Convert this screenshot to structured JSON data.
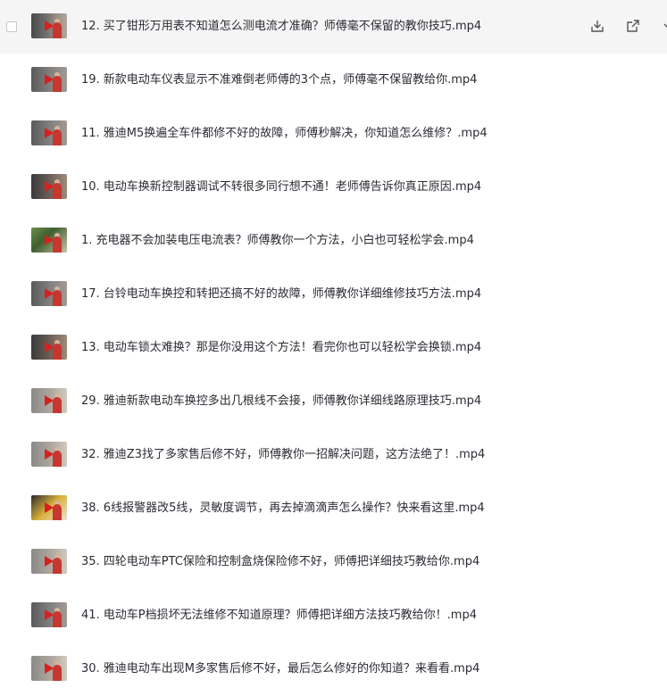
{
  "files": [
    {
      "title": "12. 买了钳形万用表不知道怎么测电流才准确？师傅毫不保留的教你技巧.mp4",
      "thumb": "v1"
    },
    {
      "title": "19. 新款电动车仪表显示不准难倒老师傅的3个点，师傅毫不保留教给你.mp4",
      "thumb": "v2"
    },
    {
      "title": "11. 雅迪M5换遍全车件都修不好的故障，师傅秒解决，你知道怎么维修？.mp4",
      "thumb": "v2"
    },
    {
      "title": "10. 电动车换新控制器调试不转很多同行想不通！老师傅告诉你真正原因.mp4",
      "thumb": "v3"
    },
    {
      "title": "1. 充电器不会加装电压电流表？师傅教你一个方法，小白也可轻松学会.mp4",
      "thumb": "v4"
    },
    {
      "title": "17. 台铃电动车换控和转把还搞不好的故障，师傅教你详细维修技巧方法.mp4",
      "thumb": "v2"
    },
    {
      "title": "13. 电动车锁太难换？那是你没用这个方法！看完你也可以轻松学会换锁.mp4",
      "thumb": "v3"
    },
    {
      "title": "29. 雅迪新款电动车换控多出几根线不会接，师傅教你详细线路原理技巧.mp4",
      "thumb": "v5"
    },
    {
      "title": "32. 雅迪Z3找了多家售后修不好，师傅教你一招解决问题，这方法绝了！.mp4",
      "thumb": "v5"
    },
    {
      "title": "38. 6线报警器改5线，灵敏度调节，再去掉滴滴声怎么操作？快来看这里.mp4",
      "thumb": "v6"
    },
    {
      "title": "35. 四轮电动车PTC保险和控制盒烧保险修不好，师傅把详细技巧教给你.mp4",
      "thumb": "v5"
    },
    {
      "title": "41. 电动车P档损坏无法维修不知道原理？师傅把详细方法技巧教给你！.mp4",
      "thumb": "v2"
    },
    {
      "title": "30. 雅迪电动车出现M多家售后修不好，最后怎么修好的你知道？来看看.mp4",
      "thumb": "v5"
    }
  ],
  "row_actions": {
    "download_icon": "download-icon",
    "share_icon": "open-external-icon",
    "more_icon": "more-icon"
  },
  "colors": {
    "hover_bg": "#f5f5f6",
    "text": "#2b2b33",
    "play": "#d62020"
  }
}
